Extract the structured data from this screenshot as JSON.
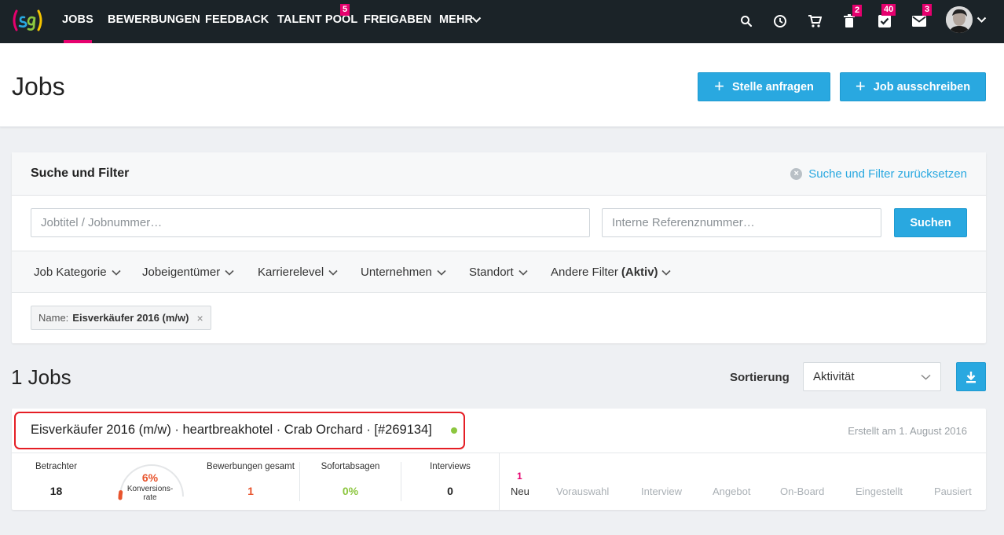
{
  "nav": {
    "items": [
      {
        "label": "JOBS",
        "active": true
      },
      {
        "label": "BEWERBUNGEN"
      },
      {
        "label": "FEEDBACK"
      },
      {
        "label": "TALENT POOL",
        "badge": "5"
      },
      {
        "label": "FREIGABEN"
      },
      {
        "label": "MEHR"
      }
    ],
    "icons": [
      "search-icon",
      "clock-icon",
      "cart-icon",
      "trash-icon",
      "checkbox-icon",
      "mail-icon"
    ],
    "trash_badge": "2",
    "tasks_badge": "40",
    "mail_badge": "3"
  },
  "header": {
    "title": "Jobs",
    "request_button": "Stelle anfragen",
    "post_button": "Job ausschreiben"
  },
  "filter": {
    "title": "Suche und Filter",
    "reset_label": "Suche und Filter zurücksetzen",
    "search_placeholder": "Jobtitel / Jobnummer…",
    "ref_placeholder": "Interne Referenznummer…",
    "search_button": "Suchen",
    "dropdowns": [
      "Job Kategorie",
      "Jobeigentümer",
      "Karrierelevel",
      "Unternehmen",
      "Standort"
    ],
    "other_filter_label": "Andere Filter",
    "other_filter_state": "(Aktiv)",
    "tag_key": "Name:",
    "tag_value": "Eisverkäufer 2016 (m/w)"
  },
  "results": {
    "count_label": "1 Jobs",
    "sort_label": "Sortierung",
    "sort_value": "Aktivität"
  },
  "job": {
    "title": "Eisverkäufer 2016 (m/w) · heartbreakhotel · Crab Orchard · [#269134]",
    "created": "Erstellt am 1. August 2016",
    "stats": {
      "viewers_label": "Betrachter",
      "viewers_value": "18",
      "conversion_pct": "6%",
      "conversion_label_1": "Konversions-",
      "conversion_label_2": "rate",
      "conversion_fraction": 0.06,
      "applications_label": "Bewerbungen gesamt",
      "applications_value": "1",
      "rejections_label": "Sofortabsagen",
      "rejections_value": "0%",
      "interviews_label": "Interviews",
      "interviews_value": "0"
    },
    "stages": [
      {
        "label": "Neu",
        "count": "1"
      },
      {
        "label": "Vorauswahl"
      },
      {
        "label": "Interview"
      },
      {
        "label": "Angebot"
      },
      {
        "label": "On-Board"
      },
      {
        "label": "Eingestellt"
      },
      {
        "label": "Pausiert"
      }
    ]
  },
  "colors": {
    "accent": "#29a8e0",
    "brand_pink": "#e6006e",
    "nav_bg": "#1b2328",
    "status_green": "#8cc63f",
    "highlight_red": "#e51e25"
  }
}
